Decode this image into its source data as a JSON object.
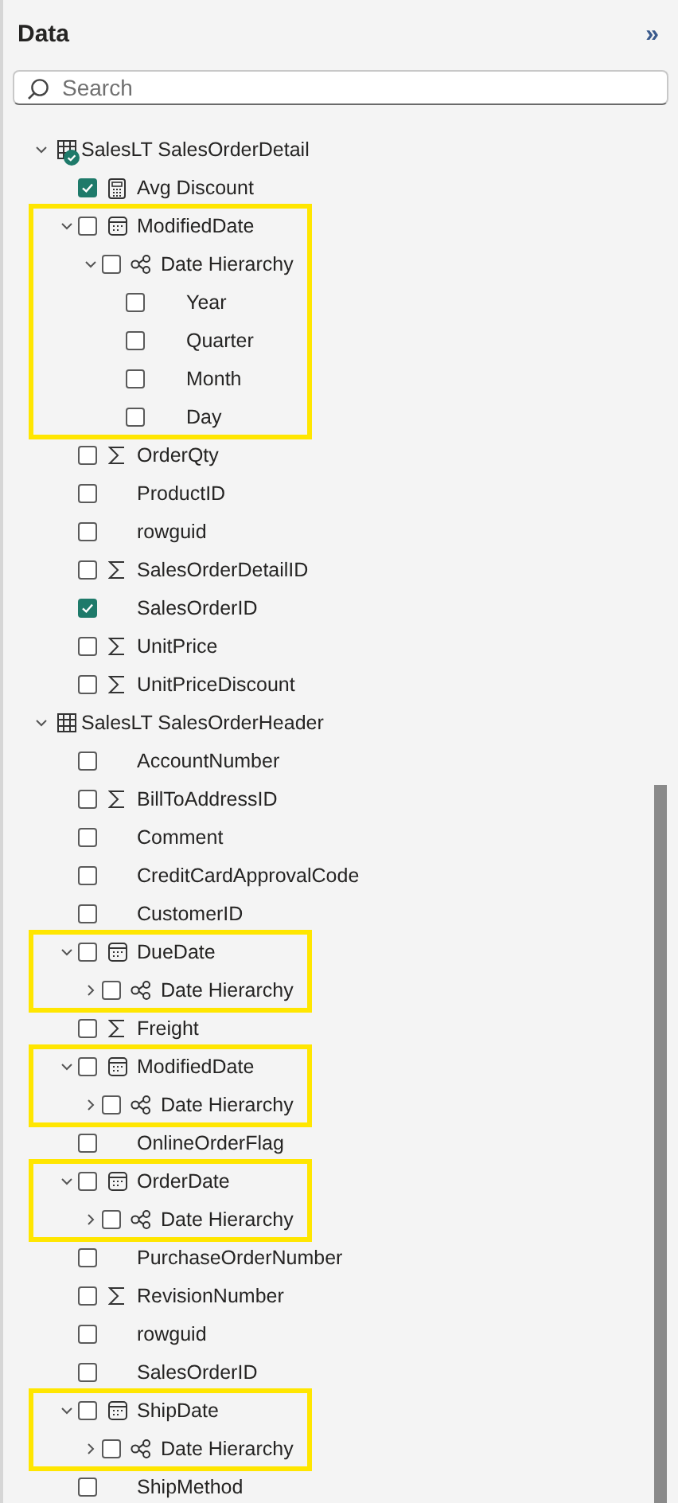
{
  "panel": {
    "title": "Data",
    "collapse_glyph": "»"
  },
  "search": {
    "placeholder": "Search"
  },
  "tables": [
    {
      "name": "SalesLT SalesOrderDetail",
      "expanded": true,
      "verified": true,
      "fields": [
        {
          "label": "Avg Discount",
          "kind": "measure",
          "checked": true,
          "highlighted": false
        },
        {
          "label": "ModifiedDate",
          "kind": "date",
          "checked": false,
          "expanded": true,
          "highlighted": true,
          "children": [
            {
              "label": "Date Hierarchy",
              "kind": "hierarchy",
              "checked": false,
              "expanded": true,
              "children": [
                {
                  "label": "Year",
                  "kind": "level",
                  "checked": false
                },
                {
                  "label": "Quarter",
                  "kind": "level",
                  "checked": false
                },
                {
                  "label": "Month",
                  "kind": "level",
                  "checked": false
                },
                {
                  "label": "Day",
                  "kind": "level",
                  "checked": false
                }
              ]
            }
          ]
        },
        {
          "label": "OrderQty",
          "kind": "sum",
          "checked": false,
          "highlighted": false
        },
        {
          "label": "ProductID",
          "kind": "plain",
          "checked": false,
          "highlighted": false
        },
        {
          "label": "rowguid",
          "kind": "plain",
          "checked": false,
          "highlighted": false
        },
        {
          "label": "SalesOrderDetailID",
          "kind": "sum",
          "checked": false,
          "highlighted": false
        },
        {
          "label": "SalesOrderID",
          "kind": "plain",
          "checked": true,
          "highlighted": false
        },
        {
          "label": "UnitPrice",
          "kind": "sum",
          "checked": false,
          "highlighted": false
        },
        {
          "label": "UnitPriceDiscount",
          "kind": "sum",
          "checked": false,
          "highlighted": false
        }
      ]
    },
    {
      "name": "SalesLT SalesOrderHeader",
      "expanded": true,
      "verified": false,
      "fields": [
        {
          "label": "AccountNumber",
          "kind": "plain",
          "checked": false,
          "highlighted": false
        },
        {
          "label": "BillToAddressID",
          "kind": "sum",
          "checked": false,
          "highlighted": false
        },
        {
          "label": "Comment",
          "kind": "plain",
          "checked": false,
          "highlighted": false
        },
        {
          "label": "CreditCardApprovalCode",
          "kind": "plain",
          "checked": false,
          "highlighted": false
        },
        {
          "label": "CustomerID",
          "kind": "plain",
          "checked": false,
          "highlighted": false
        },
        {
          "label": "DueDate",
          "kind": "date",
          "checked": false,
          "expanded": true,
          "highlighted": true,
          "children": [
            {
              "label": "Date Hierarchy",
              "kind": "hierarchy",
              "checked": false,
              "expanded": false
            }
          ]
        },
        {
          "label": "Freight",
          "kind": "sum",
          "checked": false,
          "highlighted": false
        },
        {
          "label": "ModifiedDate",
          "kind": "date",
          "checked": false,
          "expanded": true,
          "highlighted": true,
          "children": [
            {
              "label": "Date Hierarchy",
              "kind": "hierarchy",
              "checked": false,
              "expanded": false
            }
          ]
        },
        {
          "label": "OnlineOrderFlag",
          "kind": "plain",
          "checked": false,
          "highlighted": false
        },
        {
          "label": "OrderDate",
          "kind": "date",
          "checked": false,
          "expanded": true,
          "highlighted": true,
          "children": [
            {
              "label": "Date Hierarchy",
              "kind": "hierarchy",
              "checked": false,
              "expanded": false
            }
          ]
        },
        {
          "label": "PurchaseOrderNumber",
          "kind": "plain",
          "checked": false,
          "highlighted": false
        },
        {
          "label": "RevisionNumber",
          "kind": "sum",
          "checked": false,
          "highlighted": false
        },
        {
          "label": "rowguid",
          "kind": "plain",
          "checked": false,
          "highlighted": false
        },
        {
          "label": "SalesOrderID",
          "kind": "plain",
          "checked": false,
          "highlighted": false
        },
        {
          "label": "ShipDate",
          "kind": "date",
          "checked": false,
          "expanded": true,
          "highlighted": true,
          "children": [
            {
              "label": "Date Hierarchy",
              "kind": "hierarchy",
              "checked": false,
              "expanded": false
            }
          ]
        },
        {
          "label": "ShipMethod",
          "kind": "plain",
          "checked": false,
          "highlighted": false
        }
      ]
    }
  ]
}
